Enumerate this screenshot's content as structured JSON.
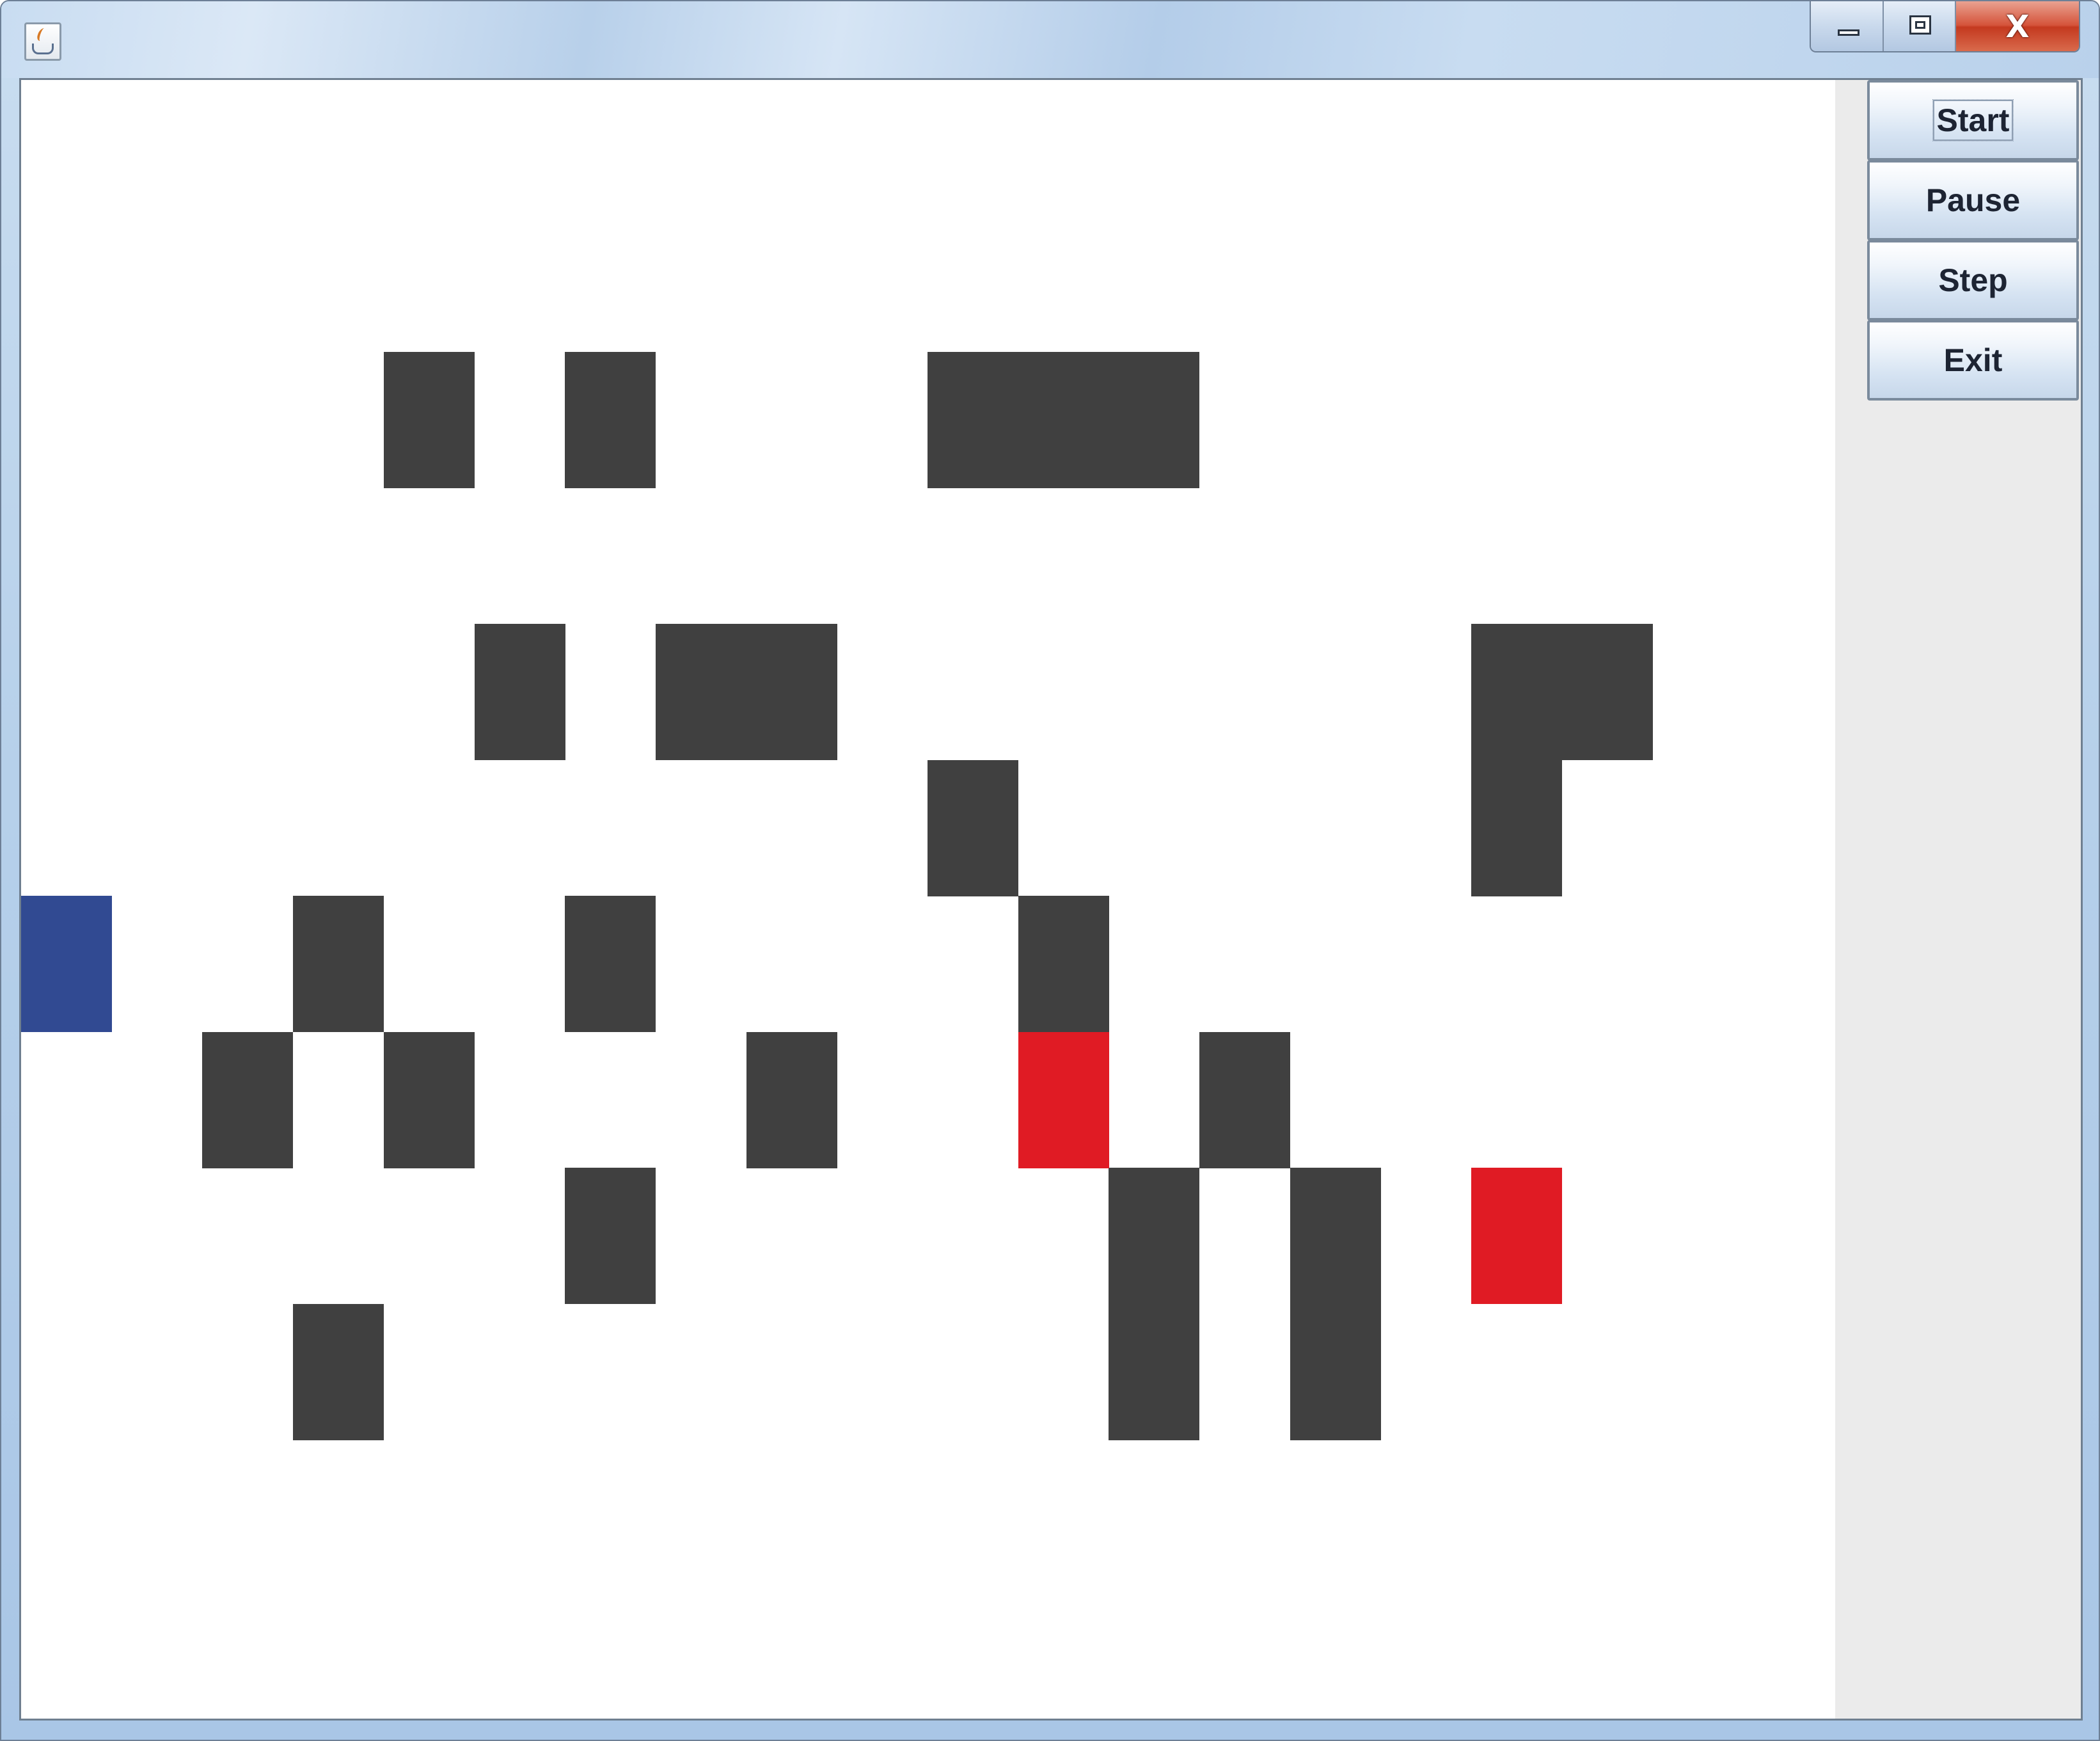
{
  "window": {
    "title": "",
    "caption_buttons": {
      "minimize": "minimize-icon",
      "maximize": "maximize-icon",
      "close_glyph": "X"
    }
  },
  "colors": {
    "wall": "#404040",
    "agent": "#314a92",
    "target": "#e01b24",
    "board_background": "#ffffff",
    "panel_background": "#ebebeb"
  },
  "controls": {
    "start_label": "Start",
    "pause_label": "Pause",
    "step_label": "Step",
    "exit_label": "Exit",
    "focused": "start"
  },
  "grid": {
    "columns": 20,
    "rows": 12,
    "walls": [
      [
        4,
        2
      ],
      [
        6,
        2
      ],
      [
        10,
        2
      ],
      [
        11,
        2
      ],
      [
        12,
        2
      ],
      [
        5,
        4
      ],
      [
        7,
        4
      ],
      [
        8,
        4
      ],
      [
        16,
        4
      ],
      [
        17,
        4
      ],
      [
        10,
        5
      ],
      [
        16,
        5
      ],
      [
        3,
        6
      ],
      [
        6,
        6
      ],
      [
        11,
        6
      ],
      [
        2,
        7
      ],
      [
        4,
        7
      ],
      [
        8,
        7
      ],
      [
        13,
        7
      ],
      [
        6,
        8
      ],
      [
        12,
        8
      ],
      [
        14,
        8
      ],
      [
        3,
        9
      ],
      [
        12,
        9
      ],
      [
        14,
        9
      ]
    ],
    "agents": [
      [
        0,
        6
      ]
    ],
    "targets": [
      [
        11,
        7
      ],
      [
        16,
        8
      ]
    ]
  }
}
